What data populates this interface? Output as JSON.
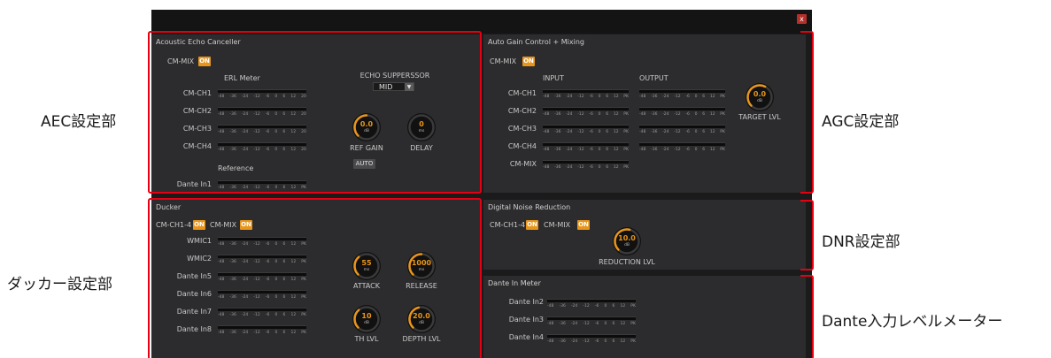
{
  "window": {
    "close_label": "x"
  },
  "meter_scale": [
    "-48",
    "-36",
    "-24",
    "-12",
    "-6",
    "0",
    "6",
    "12",
    "20"
  ],
  "meter_scale_pk": [
    "-48",
    "-36",
    "-24",
    "-12",
    "-6",
    "0",
    "6",
    "12",
    "PK"
  ],
  "aec": {
    "title": "Acoustic Echo Canceller",
    "cm_mix_label": "CM-MIX",
    "cm_mix_state": "ON",
    "erl_meter_label": "ERL Meter",
    "channels": [
      "CM-CH1",
      "CM-CH2",
      "CM-CH3",
      "CM-CH4"
    ],
    "reference_label": "Reference",
    "reference_channel": "Dante In1",
    "echo_suppressor_label": "ECHO SUPPERSSOR",
    "echo_suppressor_value": "MID",
    "dropdown_arrow": "▼",
    "ref_gain": {
      "label": "REF GAIN",
      "value": "0.0",
      "unit": "dB",
      "level": 0.5
    },
    "delay": {
      "label": "DELAY",
      "value": "0",
      "unit": "ms",
      "level": 0.0
    },
    "auto_label": "AUTO"
  },
  "agc": {
    "title": "Auto Gain Control + Mixing",
    "cm_mix_label": "CM-MIX",
    "cm_mix_state": "ON",
    "input_label": "INPUT",
    "output_label": "OUTPUT",
    "channels": [
      "CM-CH1",
      "CM-CH2",
      "CM-CH3",
      "CM-CH4",
      "CM-MIX"
    ],
    "target_lvl": {
      "label": "TARGET LVL",
      "value": "0.0",
      "unit": "dB",
      "level": 0.6
    }
  },
  "ducker": {
    "title": "Ducker",
    "cm_ch_label": "CM-CH1-4",
    "cm_ch_state": "ON",
    "cm_mix_label": "CM-MIX",
    "cm_mix_state": "ON",
    "channels": [
      "WMIC1",
      "WMIC2",
      "Dante In5",
      "Dante In6",
      "Dante In7",
      "Dante In8"
    ],
    "attack": {
      "label": "ATTACK",
      "value": "55",
      "unit": "ms",
      "level": 0.35
    },
    "release": {
      "label": "RELEASE",
      "value": "1000",
      "unit": "ms",
      "level": 0.5
    },
    "th_lvl": {
      "label": "TH LVL",
      "value": "10",
      "unit": "dB",
      "level": 0.35
    },
    "depth_lvl": {
      "label": "DEPTH LVL",
      "value": "20.0",
      "unit": "dB",
      "level": 0.45
    }
  },
  "dnr": {
    "title": "Digital Noise Reduction",
    "cm_ch_label": "CM-CH1-4",
    "cm_ch_state": "ON",
    "cm_mix_label": "CM-MIX",
    "cm_mix_state": "ON",
    "reduction_lvl": {
      "label": "REDUCTION LVL",
      "value": "10.0",
      "unit": "dB",
      "level": 0.55
    }
  },
  "dante_meter": {
    "title": "Dante In Meter",
    "channels": [
      "Dante In2",
      "Dante In3",
      "Dante In4"
    ]
  },
  "annotations": {
    "aec": "AEC設定部",
    "agc": "AGC設定部",
    "dnr": "DNR設定部",
    "ducker": "ダッカー設定部",
    "dante": "Dante入力レベルメーター"
  },
  "colors": {
    "accent": "#e8951b",
    "annotation_box": "#e60012",
    "panel": "#2c2c2e",
    "window": "#1b1b1c"
  }
}
